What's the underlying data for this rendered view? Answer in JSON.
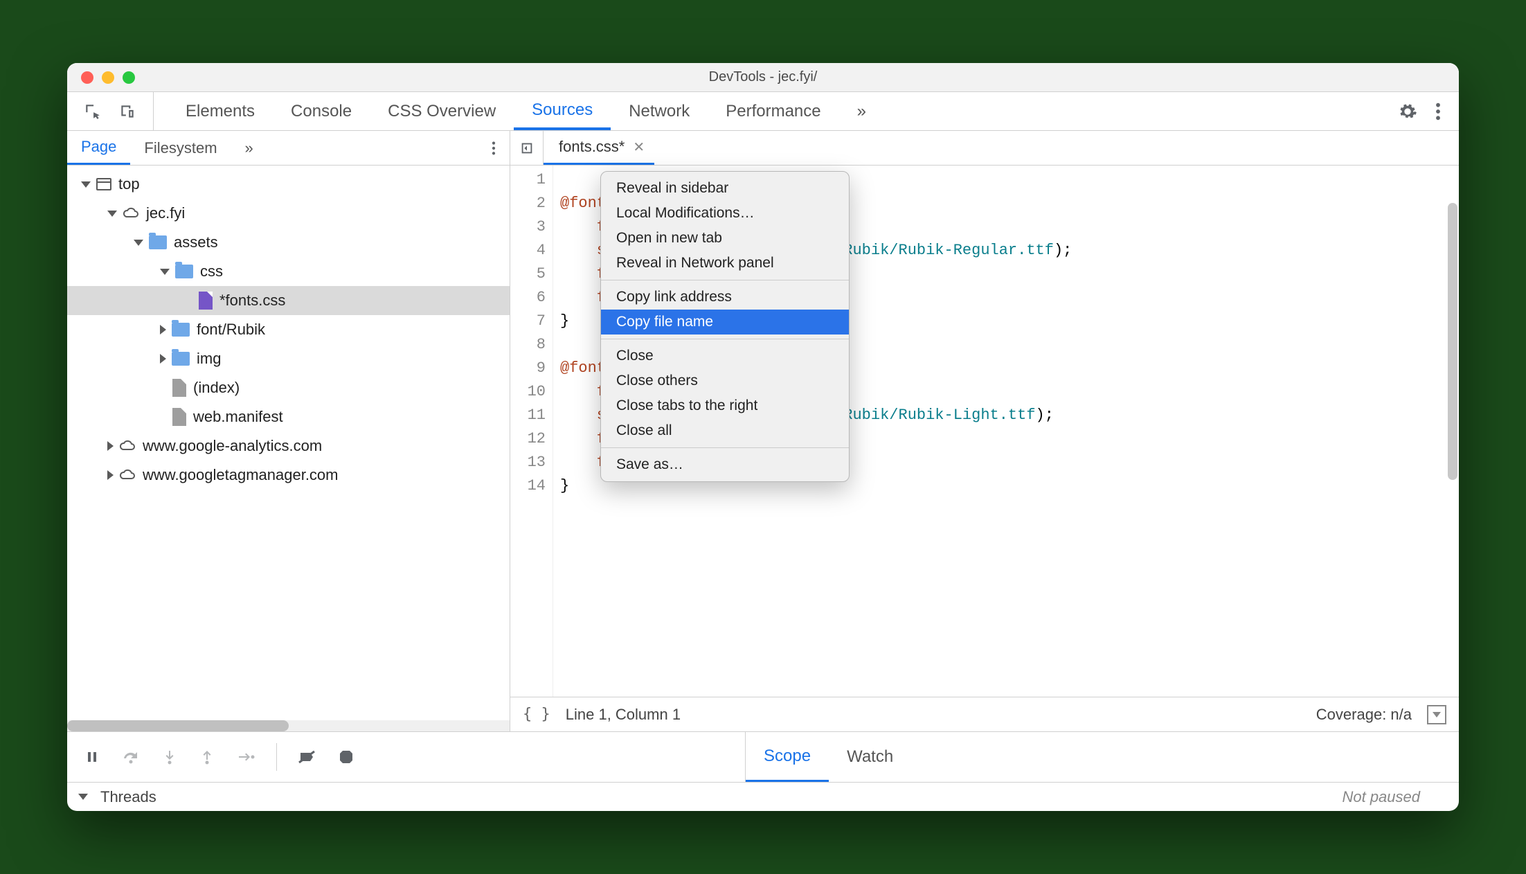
{
  "window": {
    "title": "DevTools - jec.fyi/"
  },
  "panels": {
    "items": [
      "Elements",
      "Console",
      "CSS Overview",
      "Sources",
      "Network",
      "Performance"
    ],
    "active_index": 3
  },
  "sidebar": {
    "tabs": [
      "Page",
      "Filesystem"
    ],
    "active_index": 0,
    "tree": {
      "top": "top",
      "domain": "jec.fyi",
      "assets": "assets",
      "css": "css",
      "fontscss": "*fonts.css",
      "fontrubik": "font/Rubik",
      "img": "img",
      "index": "(index)",
      "manifest": "web.manifest",
      "ga": "www.google-analytics.com",
      "gtm": "www.googletagmanager.com"
    }
  },
  "editor": {
    "tab": {
      "name": "fonts.css*",
      "dirty": true
    },
    "gutter": [
      "1",
      "2",
      "3",
      "4",
      "5",
      "6",
      "7",
      "8",
      "9",
      "10",
      "11",
      "12",
      "13",
      "14"
    ],
    "lines": {
      "l1": "@font-f",
      "l2": "    fon",
      "l3a": "    src",
      "l3b": "Rubik/Rubik-Regular.ttf",
      "l3c": ");",
      "l4": "    fon",
      "l5": "    fon",
      "l6": "}",
      "l7": "",
      "l8": "@font-f",
      "l9": "    fon",
      "l10a": "    src",
      "l10b": "Rubik/Rubik-Light.ttf",
      "l10c": ");",
      "l11": "    fon",
      "l12": "    fon",
      "l13": "}",
      "l14": ""
    },
    "status": {
      "pretty": "{ }",
      "pos": "Line 1, Column 1",
      "coverage": "Coverage: n/a"
    }
  },
  "context_menu": {
    "items": [
      "Reveal in sidebar",
      "Local Modifications…",
      "Open in new tab",
      "Reveal in Network panel",
      "Copy link address",
      "Copy file name",
      "Close",
      "Close others",
      "Close tabs to the right",
      "Close all",
      "Save as…"
    ],
    "highlighted_index": 5
  },
  "debugger": {
    "scope": "Scope",
    "watch": "Watch",
    "threads": "Threads",
    "not_paused": "Not paused"
  }
}
